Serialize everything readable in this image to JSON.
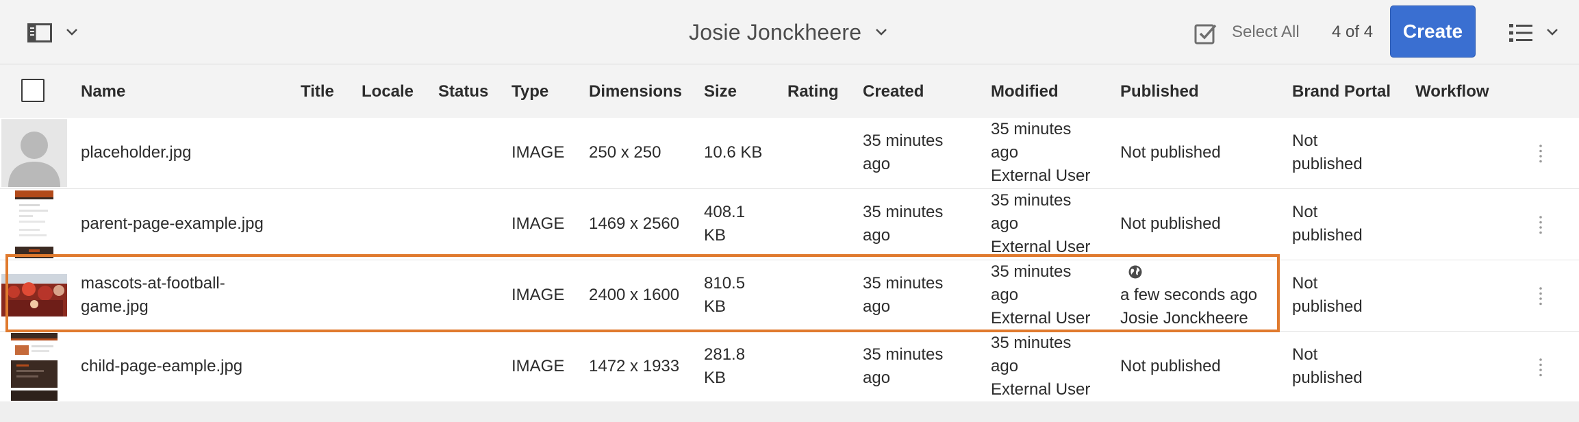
{
  "header": {
    "title": "Josie Jonckheere",
    "select_all": "Select All",
    "count": "4 of 4",
    "create_label": "Create"
  },
  "columns": [
    "Name",
    "Title",
    "Locale",
    "Status",
    "Type",
    "Dimensions",
    "Size",
    "Rating",
    "Created",
    "Modified",
    "Published",
    "Brand Portal",
    "Workflow"
  ],
  "rows": [
    {
      "name": [
        "placeholder.jpg"
      ],
      "type": "IMAGE",
      "dimensions": "250 x 250",
      "size": [
        "10.6 KB"
      ],
      "created": [
        "35 minutes",
        "ago"
      ],
      "modified": [
        "35 minutes",
        "ago",
        "External User"
      ],
      "published": [
        "Not published"
      ],
      "brand_portal": [
        "Not",
        "published"
      ]
    },
    {
      "name": [
        "parent-page-example.jpg"
      ],
      "type": "IMAGE",
      "dimensions": "1469 x 2560",
      "size": [
        "408.1",
        "KB"
      ],
      "created": [
        "35 minutes",
        "ago"
      ],
      "modified": [
        "35 minutes",
        "ago",
        "External User"
      ],
      "published": [
        "Not published"
      ],
      "brand_portal": [
        "Not",
        "published"
      ]
    },
    {
      "name": [
        "mascots-at-football-",
        "game.jpg"
      ],
      "type": "IMAGE",
      "dimensions": "2400 x 1600",
      "size": [
        "810.5",
        "KB"
      ],
      "created": [
        "35 minutes",
        "ago"
      ],
      "modified": [
        "35 minutes",
        "ago",
        "External User"
      ],
      "published": [
        "a few seconds ago",
        "Josie Jonckheere"
      ],
      "brand_portal": [
        "Not",
        "published"
      ],
      "published_icon": "globe-icon"
    },
    {
      "name": [
        "child-page-eample.jpg"
      ],
      "type": "IMAGE",
      "dimensions": "1472 x 1933",
      "size": [
        "281.8",
        "KB"
      ],
      "created": [
        "35 minutes",
        "ago"
      ],
      "modified": [
        "35 minutes",
        "ago",
        "External User"
      ],
      "published": [
        "Not published"
      ],
      "brand_portal": [
        "Not",
        "published"
      ]
    }
  ],
  "icons": {
    "rail_toggle": "rail-toggle-icon",
    "select_all": "checkbox-checked-icon",
    "view_switcher": "list-view-icon",
    "drag": "drag-handle-icon",
    "placeholder": "user-avatar-icon"
  },
  "colors": {
    "accent": "#3a6fd1",
    "highlight": "#e07a2e",
    "background": "#f0f0f0"
  }
}
